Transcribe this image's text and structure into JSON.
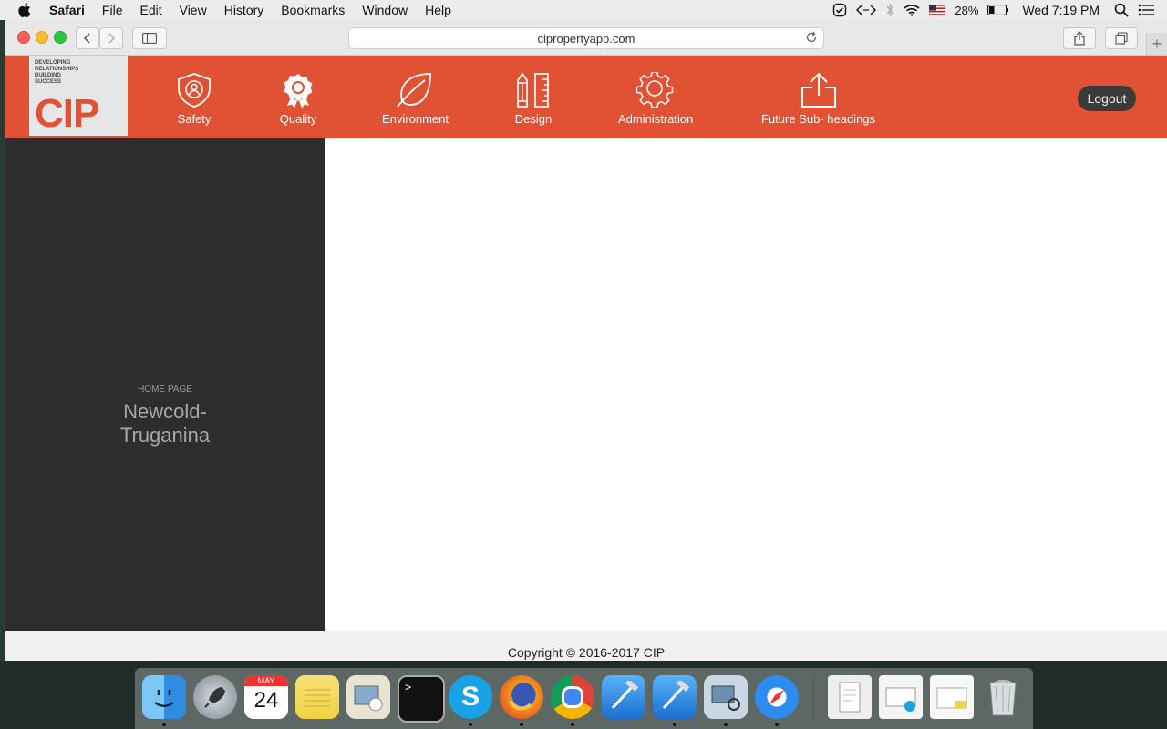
{
  "menubar": {
    "app": "Safari",
    "items": [
      "File",
      "Edit",
      "View",
      "History",
      "Bookmarks",
      "Window",
      "Help"
    ],
    "battery": "28%",
    "clock": "Wed 7:19 PM"
  },
  "browser": {
    "url": "cipropertyapp.com"
  },
  "header": {
    "logo_tagline": [
      "DEVELOPING",
      "RELATIONSHIPS",
      "BUILDING",
      "SUCCESS"
    ],
    "logo_mark": "CIP",
    "nav": [
      {
        "label": "Safety",
        "icon": "shield-person-icon"
      },
      {
        "label": "Quality",
        "icon": "award-ribbon-icon"
      },
      {
        "label": "Environment",
        "icon": "leaf-icon"
      },
      {
        "label": "Design",
        "icon": "pencil-ruler-icon"
      },
      {
        "label": "Administration",
        "icon": "gear-icon"
      },
      {
        "label": "Future Sub- headings",
        "icon": "share-upload-icon"
      }
    ],
    "logout": "Logout"
  },
  "sidebar": {
    "subtitle": "HOME PAGE",
    "title_line1": "Newcold-",
    "title_line2": "Truganina"
  },
  "footer": {
    "copyright": "Copyright © 2016-2017 CIP"
  },
  "dock": {
    "calendar_month": "MAY",
    "calendar_day": "24"
  }
}
